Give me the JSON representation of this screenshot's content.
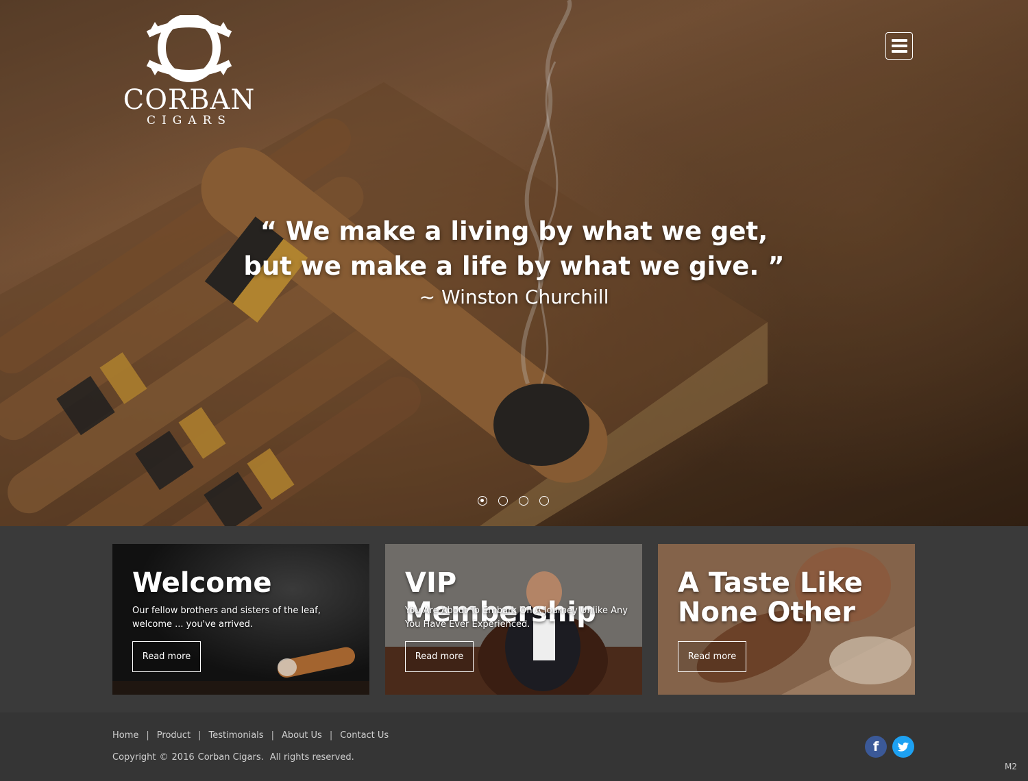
{
  "header": {
    "logo": {
      "wordmark": "CORBAN",
      "submark": "CIGARS"
    },
    "menu_icon": "hamburger-menu-icon"
  },
  "hero": {
    "quote_line1": "“ We make a living by what we get,",
    "quote_line2": "but we make a life by what we give. ”",
    "author": "~ Winston Churchill",
    "slides": 4,
    "active_slide": 1
  },
  "cards": [
    {
      "title": "Welcome",
      "text": "Our fellow brothers and sisters of the leaf, welcome ... you've arrived.",
      "button": "Read more"
    },
    {
      "title": "VIP Membership",
      "text": "You Are About To Embark On A Journey Unlike Any You Have Ever Experienced.",
      "button": "Read more"
    },
    {
      "title_line1": "A Taste Like",
      "title_line2": "None Other",
      "button": "Read more"
    }
  ],
  "footer": {
    "nav": [
      "Home",
      "Product",
      "Testimonials",
      "About Us",
      "Contact Us"
    ],
    "separator": "|",
    "copyright": {
      "word": "Copyright",
      "symbol": "©",
      "year": "2016",
      "company": "Corban Cigars.",
      "rights": "All rights reserved."
    },
    "social": [
      {
        "icon": "facebook-icon",
        "glyph": "f",
        "color": "#3b5998"
      },
      {
        "icon": "twitter-icon",
        "color": "#1da1f2"
      }
    ],
    "version": "M2"
  }
}
